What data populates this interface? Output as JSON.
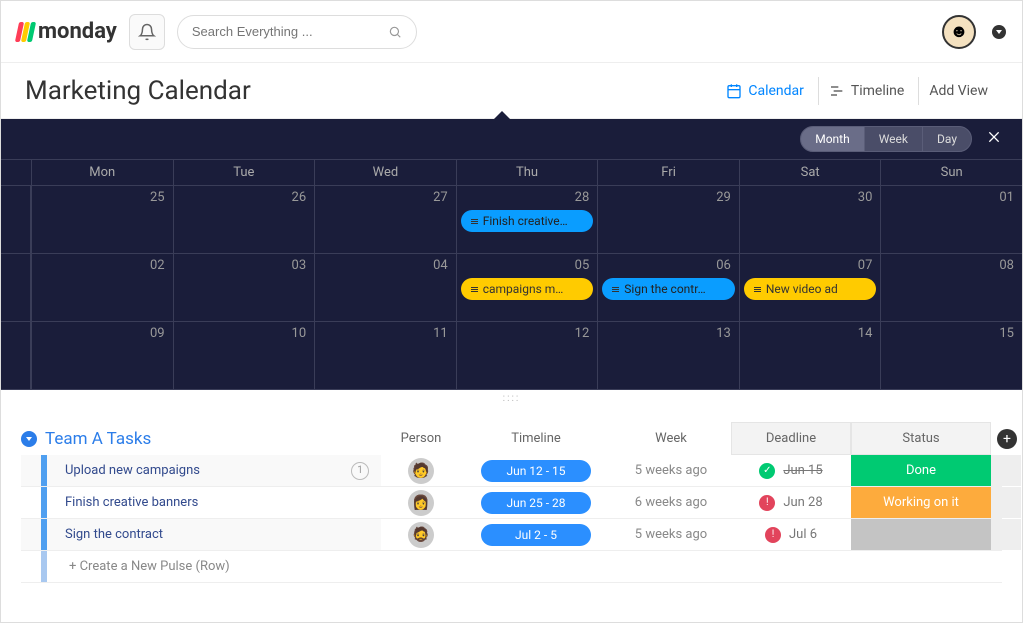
{
  "header": {
    "brand": "monday",
    "search_placeholder": "Search Everything ..."
  },
  "page": {
    "title": "Marketing Calendar"
  },
  "views": {
    "calendar": "Calendar",
    "timeline": "Timeline",
    "add": "Add View"
  },
  "range": {
    "month": "Month",
    "week": "Week",
    "day": "Day"
  },
  "dow": [
    "Mon",
    "Tue",
    "Wed",
    "Thu",
    "Fri",
    "Sat",
    "Sun"
  ],
  "weeks": [
    {
      "days": [
        "25",
        "26",
        "27",
        "28",
        "29",
        "30",
        "01"
      ]
    },
    {
      "days": [
        "02",
        "03",
        "04",
        "05",
        "06",
        "07",
        "08"
      ]
    },
    {
      "days": [
        "09",
        "10",
        "11",
        "12",
        "13",
        "14",
        "15"
      ]
    }
  ],
  "events": {
    "w0": {
      "thu": {
        "label": "Finish creative…",
        "color": "blue"
      }
    },
    "w1": {
      "thu": {
        "label": "campaigns m…",
        "color": "yellow"
      },
      "fri": {
        "label": "Sign the contr…",
        "color": "blue"
      },
      "sat": {
        "label": "New video ad",
        "color": "yellow"
      }
    }
  },
  "group": {
    "title": "Team A Tasks",
    "cols": {
      "person": "Person",
      "timeline": "Timeline",
      "week": "Week",
      "deadline": "Deadline",
      "status": "Status"
    }
  },
  "tasks": [
    {
      "name": "Upload new campaigns",
      "extra": "1",
      "timeline": "Jun 12 - 15",
      "week": "5 weeks ago",
      "deadline": "Jun 15",
      "dl_state": "ok",
      "dl_strike": true,
      "status": "Done",
      "status_key": "done"
    },
    {
      "name": "Finish creative banners",
      "extra": "",
      "timeline": "Jun 25 - 28",
      "week": "6 weeks ago",
      "deadline": "Jun 28",
      "dl_state": "warn",
      "dl_strike": false,
      "status": "Working on it",
      "status_key": "working"
    },
    {
      "name": "Sign the contract",
      "extra": "",
      "timeline": "Jul 2 - 5",
      "week": "5 weeks ago",
      "deadline": "Jul 6",
      "dl_state": "warn",
      "dl_strike": false,
      "status": "",
      "status_key": "empty"
    }
  ],
  "new_pulse": "+ Create a New Pulse (Row)"
}
